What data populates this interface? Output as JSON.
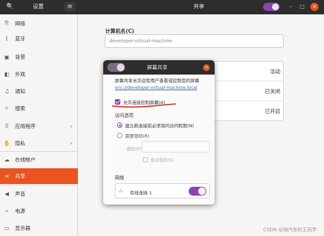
{
  "titlebar": {
    "left_title": "设置",
    "center_title": "共享",
    "search_glyph": "🔍",
    "menu_glyph": "≡",
    "minimize_glyph": "–",
    "maximize_glyph": "□",
    "close_glyph": "✕"
  },
  "sidebar": {
    "items": [
      {
        "label": "网络",
        "icon": "network-icon",
        "glyph": "⎘"
      },
      {
        "label": "蓝牙",
        "icon": "bluetooth-icon",
        "glyph": "ᛒ"
      },
      {
        "label": "背景",
        "icon": "background-icon",
        "glyph": "▣"
      },
      {
        "label": "外观",
        "icon": "appearance-icon",
        "glyph": "◧"
      },
      {
        "label": "通知",
        "icon": "bell-icon",
        "glyph": "♫"
      },
      {
        "label": "搜索",
        "icon": "search-icon",
        "glyph": "⌕"
      },
      {
        "label": "应用程序",
        "icon": "apps-icon",
        "glyph": "⠿",
        "chevron": "›"
      },
      {
        "label": "隐私",
        "icon": "hand-icon",
        "glyph": "✋",
        "chevron": "›"
      },
      {
        "label": "在线帐户",
        "icon": "cloud-icon",
        "glyph": "☁"
      },
      {
        "label": "共享",
        "icon": "share-icon",
        "glyph": "⋖",
        "active": true
      },
      {
        "label": "声音",
        "icon": "speaker-icon",
        "glyph": "◀"
      },
      {
        "label": "电源",
        "icon": "power-icon",
        "glyph": "⌁"
      },
      {
        "label": "显示器",
        "icon": "monitor-icon",
        "glyph": "▭"
      }
    ]
  },
  "main": {
    "computer_name_label": "计算机名(C)",
    "computer_name_value": "developer-virtual-machine",
    "rows": [
      {
        "status": "活动"
      },
      {
        "status": "已关闭"
      },
      {
        "status": "已开启"
      }
    ]
  },
  "dialog": {
    "title": "屏幕共享",
    "close_glyph": "✕",
    "description": "屏幕共享允许远程用户查看或控制您的屏幕",
    "link": "vnc://developer-virtual-machine.local",
    "allow_control_label": "允许连接控制屏幕(A)",
    "access_title": "访问选项",
    "radio_new_connections": "建立新连接前必须询问访问权限(N)",
    "radio_require_password": "需要密码(R)",
    "password_label": "密码(P):",
    "show_password_label": "显示密码(S)",
    "network_title": "网络",
    "network_glyph": "⛬",
    "network_connection": "有线连接 1"
  },
  "colors": {
    "accent": "#e95420",
    "toggle_on": "#8e44ad",
    "titlebar": "#2d2d2d"
  },
  "watermark": "CSDN @骑汽车的王同学"
}
